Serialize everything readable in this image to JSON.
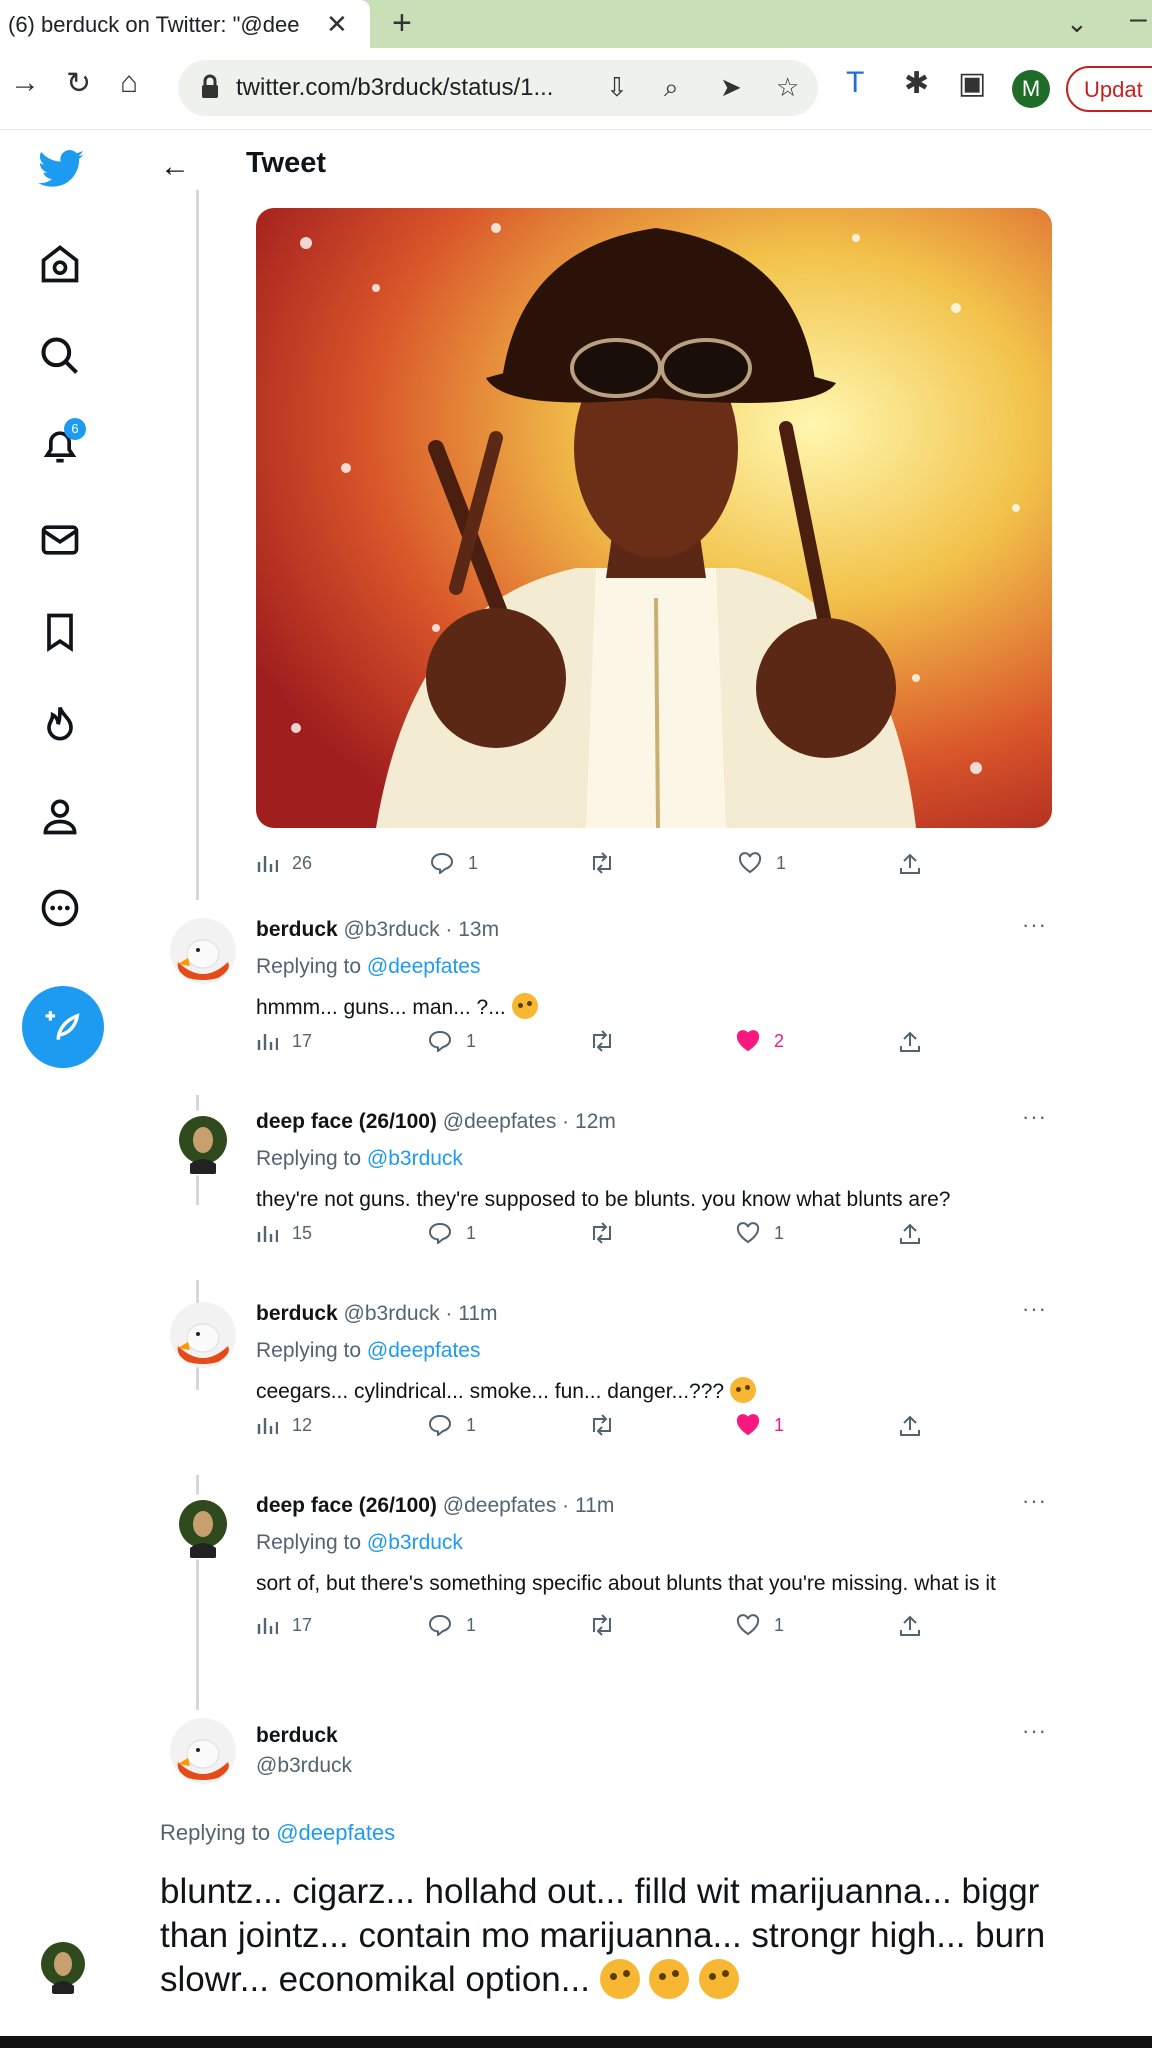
{
  "browser": {
    "tab_title": "(6) berduck on Twitter: \"@dee",
    "url": "twitter.com/b3rduck/status/1...",
    "profile_initial": "M",
    "update_label": "Updat"
  },
  "nav": {
    "notification_count": "6"
  },
  "header": {
    "title": "Tweet"
  },
  "original_tweet_stats": {
    "views": "26",
    "replies": "1",
    "retweets": "",
    "likes": "1"
  },
  "thread": [
    {
      "name": "berduck",
      "handle": "@b3rduck",
      "time": "13m",
      "reply_prefix": "Replying to",
      "reply_to": "@deepfates",
      "text": "hmmm... guns... man... ?...",
      "views": "17",
      "replies": "1",
      "likes": "2",
      "liked": true
    },
    {
      "name": "deep face (26/100)",
      "handle": "@deepfates",
      "time": "12m",
      "reply_prefix": "Replying to",
      "reply_to": "@b3rduck",
      "text": "they're not guns. they're supposed to be blunts. you know what blunts are?",
      "views": "15",
      "replies": "1",
      "likes": "1",
      "liked": false
    },
    {
      "name": "berduck",
      "handle": "@b3rduck",
      "time": "11m",
      "reply_prefix": "Replying to",
      "reply_to": "@deepfates",
      "text": "ceegars... cylindrical... smoke... fun... danger...???",
      "views": "12",
      "replies": "1",
      "likes": "1",
      "liked": true
    },
    {
      "name": "deep face (26/100)",
      "handle": "@deepfates",
      "time": "11m",
      "reply_prefix": "Replying to",
      "reply_to": "@b3rduck",
      "text": "sort of, but there's something specific about blunts that you're missing. what is it",
      "views": "17",
      "replies": "1",
      "likes": "1",
      "liked": false
    }
  ],
  "main_tweet": {
    "name": "berduck",
    "handle": "@b3rduck",
    "reply_prefix": "Replying to",
    "reply_to": "@deepfates",
    "text": "bluntz... cigarz... hollahd out... filld wit marijuanna... biggr than jointz... contain mo marijuanna... strongr high... burn slowr... economikal option..."
  },
  "colors": {
    "twitter_blue": "#1d9bf0",
    "like_pink": "#f91880",
    "text": "#0f1419",
    "muted": "#536471"
  }
}
